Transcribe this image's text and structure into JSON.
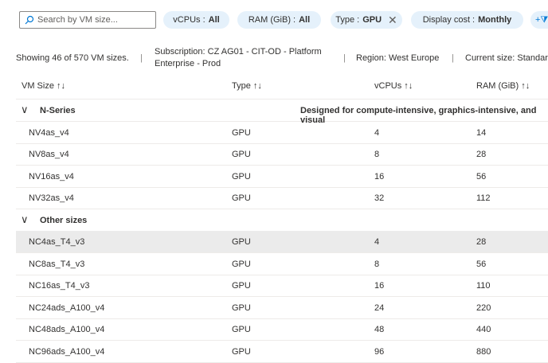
{
  "search": {
    "placeholder": "Search by VM size..."
  },
  "filters": [
    {
      "label": "vCPUs : ",
      "value": "All"
    },
    {
      "label": "RAM (GiB) : ",
      "value": "All"
    },
    {
      "label": "Type : ",
      "value": "GPU"
    },
    {
      "label": "Display cost : ",
      "value": "Monthly"
    }
  ],
  "info": {
    "showing": "Showing 46 of 570 VM sizes.",
    "subscription": "Subscription: CZ AG01 - CIT-OD - Platform Enterprise - Prod",
    "region": "Region: West Europe",
    "current": "Current size: Standard"
  },
  "columns": [
    "VM Size",
    "Type",
    "vCPUs",
    "RAM (GiB)"
  ],
  "sort_icon": "↑↓",
  "groups": [
    {
      "name": "N-Series",
      "description": "Designed for compute-intensive, graphics-intensive, and visual",
      "rows": [
        [
          "NV4as_v4",
          "GPU",
          "4",
          "14"
        ],
        [
          "NV8as_v4",
          "GPU",
          "8",
          "28"
        ],
        [
          "NV16as_v4",
          "GPU",
          "16",
          "56"
        ],
        [
          "NV32as_v4",
          "GPU",
          "32",
          "112"
        ]
      ]
    },
    {
      "name": "Other sizes",
      "description": "",
      "rows": [
        [
          "NC4as_T4_v3",
          "GPU",
          "4",
          "28"
        ],
        [
          "NC8as_T4_v3",
          "GPU",
          "8",
          "56"
        ],
        [
          "NC16as_T4_v3",
          "GPU",
          "16",
          "110"
        ],
        [
          "NC24ads_A100_v4",
          "GPU",
          "24",
          "220"
        ],
        [
          "NC48ads_A100_v4",
          "GPU",
          "48",
          "440"
        ],
        [
          "NC96ads_A100_v4",
          "GPU",
          "96",
          "880"
        ]
      ]
    }
  ],
  "selected_row": "NC4as_T4_v3"
}
